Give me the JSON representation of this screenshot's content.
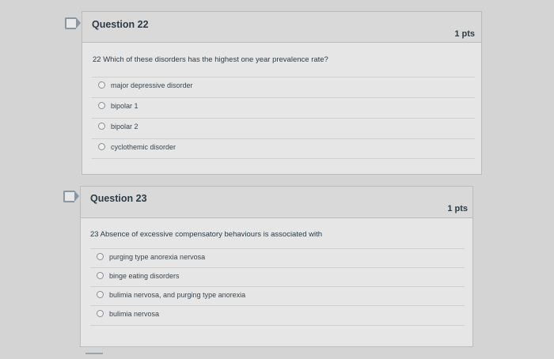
{
  "questions": [
    {
      "title": "Question 22",
      "points": "1 pts",
      "text": "22 Which of these disorders has the highest one year prevalence rate?",
      "answers": [
        "major depressive disorder",
        "bipolar 1",
        "bipolar 2",
        "cyclothemic disorder"
      ]
    },
    {
      "title": "Question 23",
      "points": "1 pts",
      "text": "23 Absence of excessive compensatory behaviours is associated with",
      "answers": [
        "purging type anorexia nervosa",
        "binge eating disorders",
        "bulimia nervosa, and purging type anorexia",
        "bulimia nervosa"
      ]
    }
  ]
}
